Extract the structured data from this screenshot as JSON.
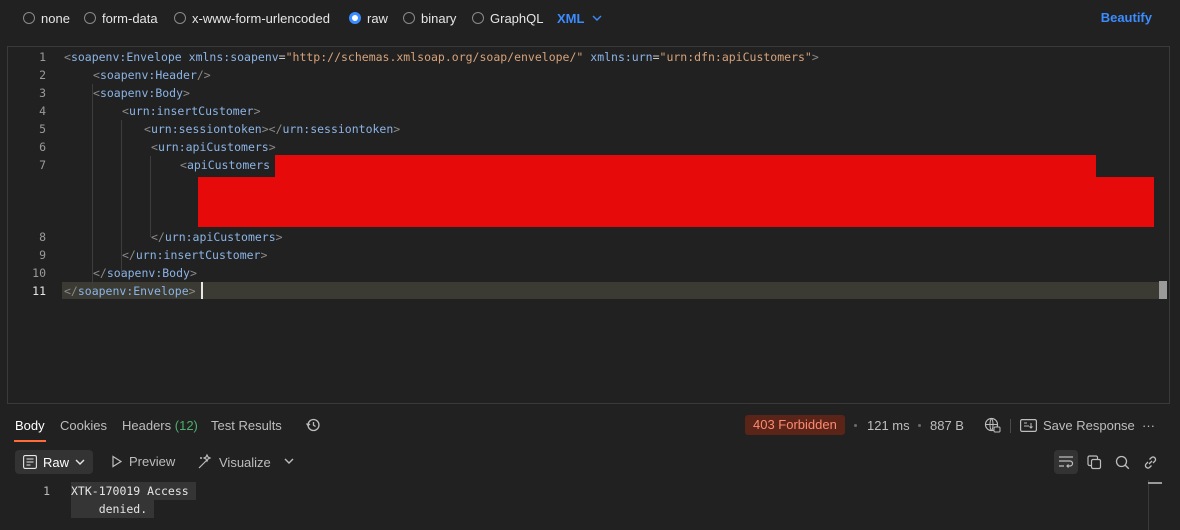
{
  "body_types": {
    "options": [
      "none",
      "form-data",
      "x-www-form-urlencoded",
      "raw",
      "binary",
      "GraphQL"
    ],
    "selected": "raw",
    "language": "XML",
    "beautify_label": "Beautify"
  },
  "editor": {
    "line_numbers": [
      "1",
      "2",
      "3",
      "4",
      "5",
      "6",
      "7",
      "8",
      "9",
      "10",
      "11"
    ],
    "active_line": "11",
    "lines": {
      "l1": {
        "open": "<",
        "tag": "soapenv:Envelope",
        "attr1": "xmlns:soapenv",
        "val1": "\"http://schemas.xmlsoap.org/soap/envelope/\"",
        "attr2": "xmlns:urn",
        "val2": "\"urn:dfn:apiCustomers\"",
        "close": ">"
      },
      "l2": {
        "open": "<",
        "tag": "soapenv:Header",
        "close": "/>"
      },
      "l3": {
        "open": "<",
        "tag": "soapenv:Body",
        "close": ">"
      },
      "l4": {
        "open": "<",
        "tag": "urn:insertCustomer",
        "close": ">"
      },
      "l5": {
        "open": "<",
        "tag": "urn:sessiontoken",
        "mid": "></",
        "tag2": "urn:sessiontoken",
        "close": ">"
      },
      "l6": {
        "open": "<",
        "tag": "urn:apiCustomers",
        "close": ">"
      },
      "l7": {
        "open": "<",
        "tag": "apiCustomers"
      },
      "l8": {
        "open": "</",
        "tag": "urn:apiCustomers",
        "close": ">"
      },
      "l9": {
        "open": "</",
        "tag": "urn:insertCustomer",
        "close": ">"
      },
      "l10": {
        "open": "</",
        "tag": "soapenv:Body",
        "close": ">"
      },
      "l11": {
        "open": "</",
        "tag": "soapenv:Envelope",
        "close": ">"
      }
    },
    "redaction_color": "#e60a0a"
  },
  "response": {
    "tabs": {
      "body": "Body",
      "cookies": "Cookies",
      "headers": "Headers",
      "headers_count": "(12)",
      "test_results": "Test Results"
    },
    "status": "403 Forbidden",
    "time": "121 ms",
    "size": "887 B",
    "save_label": "Save Response",
    "more_label": "···",
    "view_mode": "Raw",
    "preview_label": "Preview",
    "visualize_label": "Visualize",
    "line_number": "1",
    "body_lines": [
      "XTK-170019 Access",
      "    denied."
    ]
  },
  "colors": {
    "accent": "#3b8cff",
    "status_bg": "#5a2418",
    "status_text": "#ff8a70",
    "tab_indicator": "#ff6c37",
    "count_green": "#4caf6e"
  },
  "icons": [
    "chevron-down-icon",
    "history-icon",
    "globe-lock-icon",
    "save-response-icon",
    "more-icon",
    "raw-icon",
    "play-icon",
    "visualize-icon",
    "wrap-icon",
    "copy-icon",
    "search-icon",
    "link-icon"
  ]
}
